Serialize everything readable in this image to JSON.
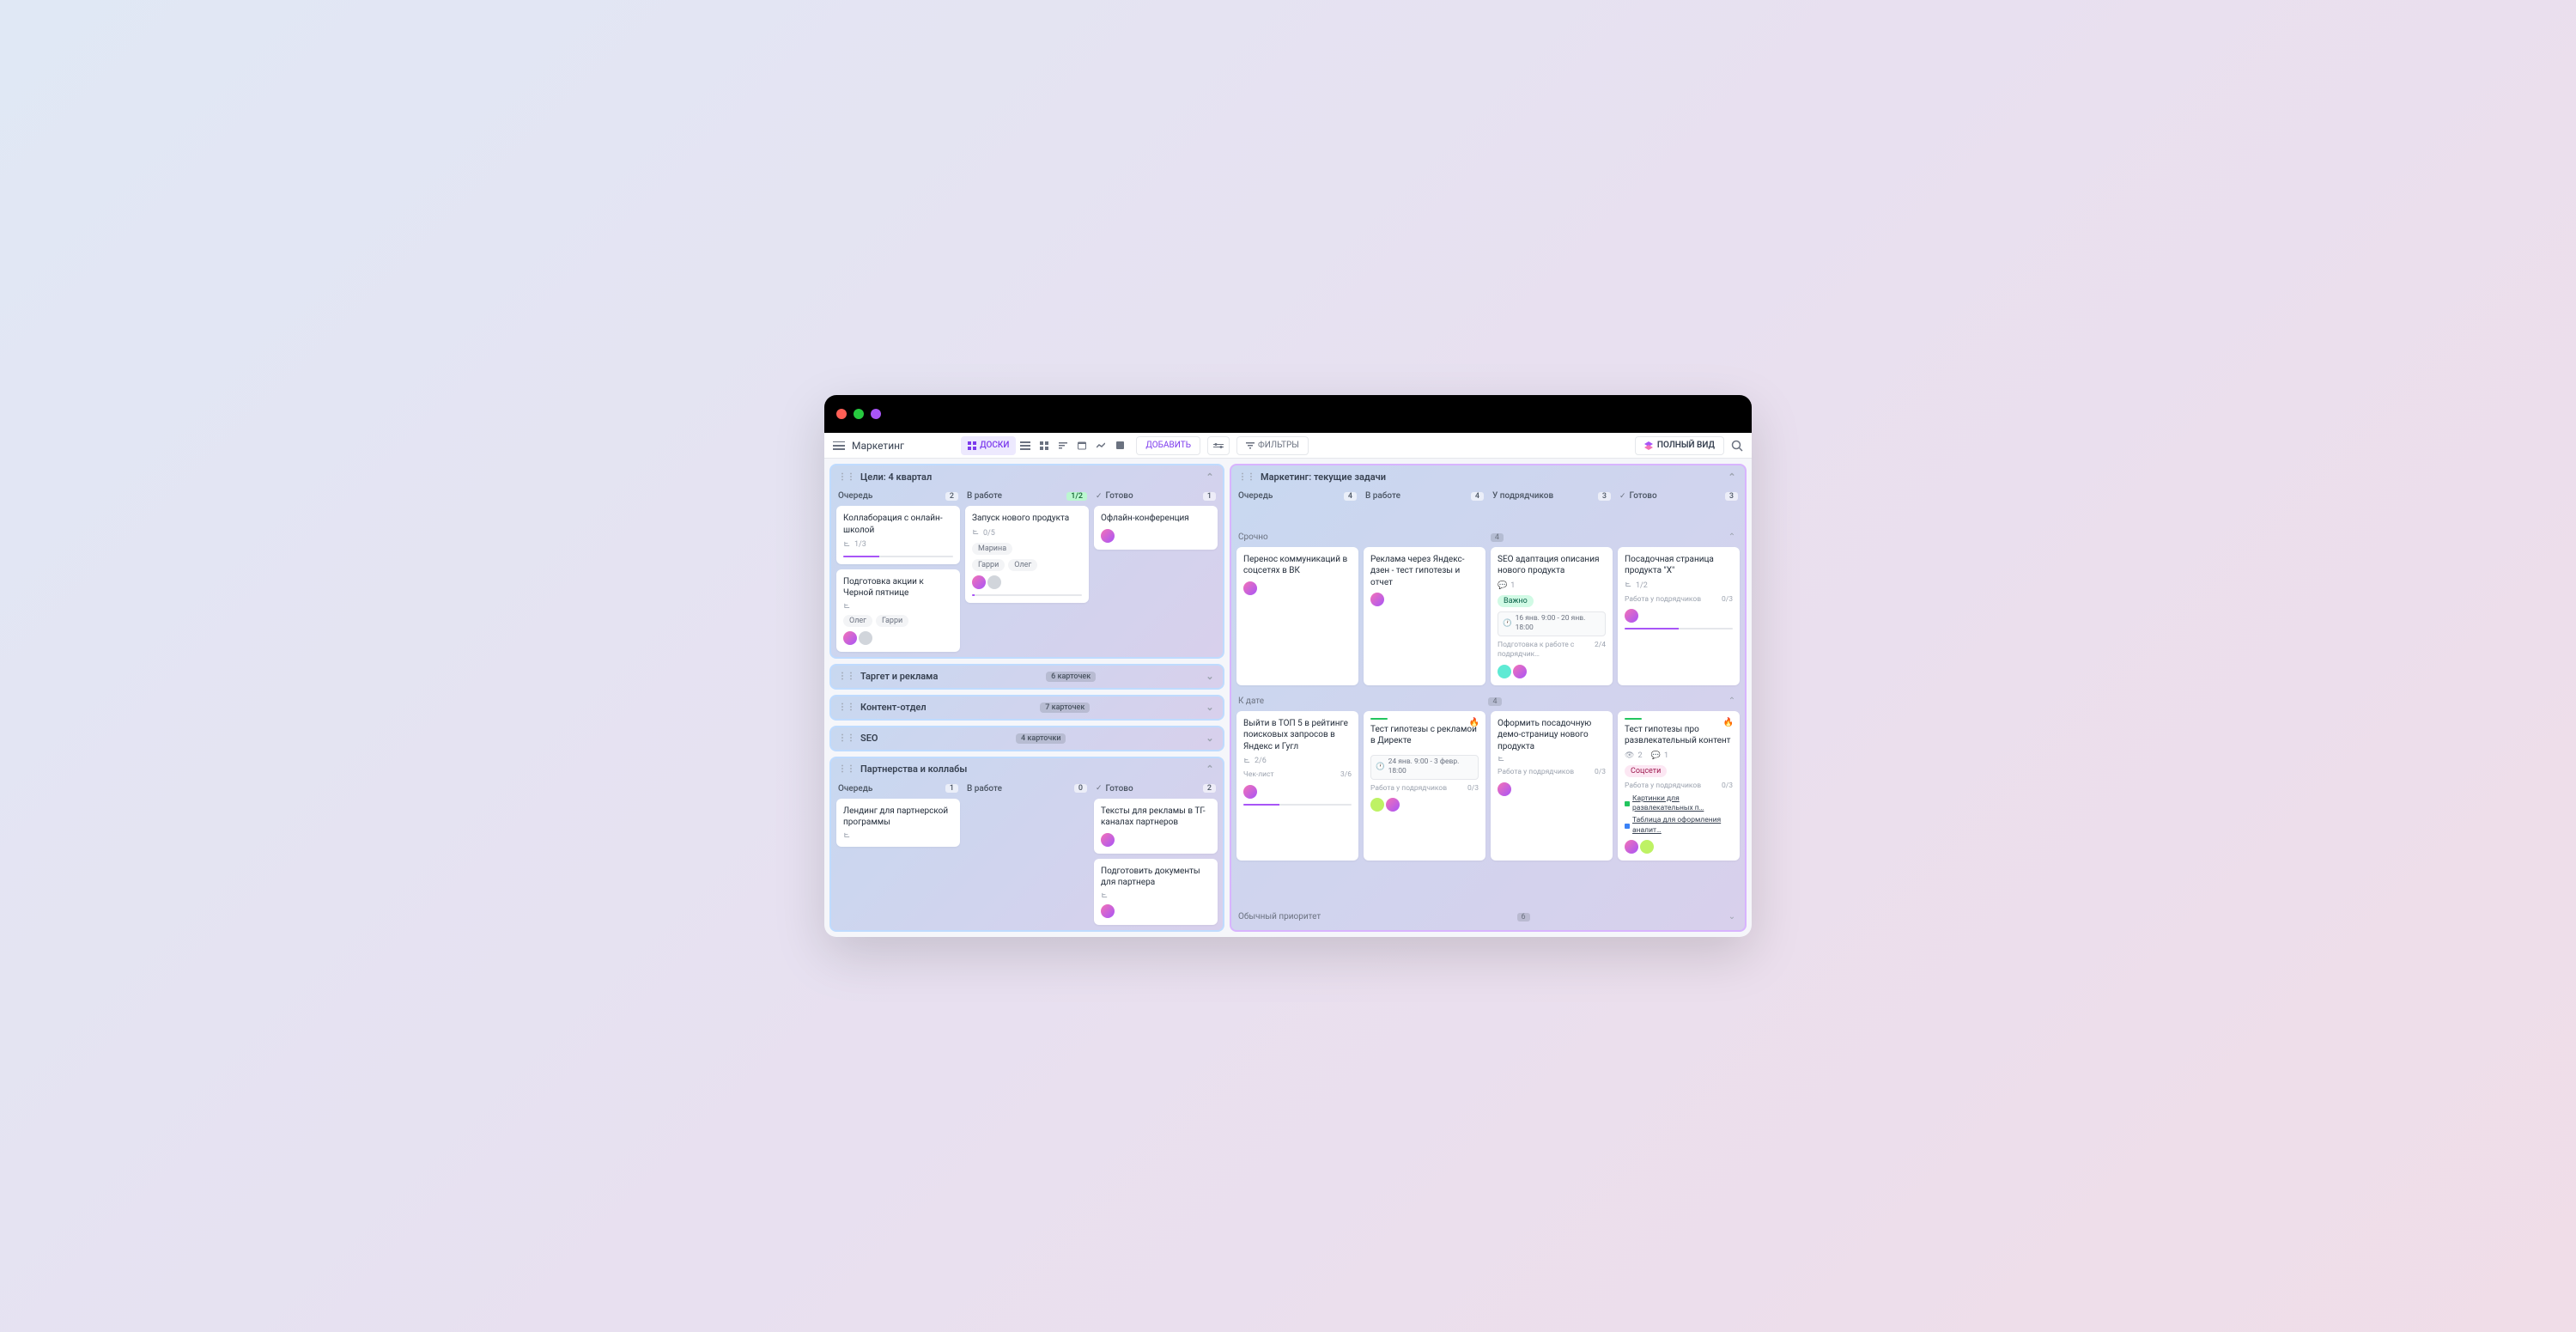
{
  "toolbar": {
    "title": "Маркетинг",
    "boards_label": "ДОСКИ",
    "add_label": "ДОБАВИТЬ",
    "filters_label": "ФИЛЬТРЫ",
    "full_view_label": "ПОЛНЫЙ ВИД"
  },
  "left": {
    "goals": {
      "title": "Цели: 4 квартал",
      "columns": [
        {
          "name": "Очередь",
          "count": "2"
        },
        {
          "name": "В работе",
          "count": "1/2"
        },
        {
          "name": "Готово",
          "count": "1",
          "done": true
        }
      ],
      "c0": [
        {
          "title": "Коллаборация с онлайн-школой",
          "sub": "1/3",
          "progress": 33
        },
        {
          "title": "Подготовка акции к Черной пятнице",
          "tags": [
            "Олег",
            "Гарри"
          ],
          "avatars": 2
        }
      ],
      "c1": [
        {
          "title": "Запуск нового продукта",
          "sub": "0/5",
          "tags": [
            "Марина",
            "Гарри",
            "Олег"
          ],
          "avatars": 2,
          "progress": 0
        }
      ],
      "c2": [
        {
          "title": "Офлайн-конференция",
          "avatars": 1
        }
      ]
    },
    "collapsed": [
      {
        "title": "Таргет и реклама",
        "count": "6 карточек"
      },
      {
        "title": "Контент-отдел",
        "count": "7 карточек"
      },
      {
        "title": "SEO",
        "count": "4 карточки"
      }
    ],
    "partners": {
      "title": "Партнерства и коллабы",
      "columns": [
        {
          "name": "Очередь",
          "count": "1"
        },
        {
          "name": "В работе",
          "count": "0"
        },
        {
          "name": "Готово",
          "count": "2",
          "done": true
        }
      ],
      "c0": [
        {
          "title": "Лендинг для партнерской программы"
        }
      ],
      "c2": [
        {
          "title": "Тексты для рекламы в ТГ-каналах партнеров",
          "avatars": 1
        },
        {
          "title": "Подготовить документы для партнера",
          "avatars": 1
        }
      ]
    }
  },
  "right": {
    "title": "Маркетинг: текущие задачи",
    "columns": [
      {
        "name": "Очередь",
        "count": "4"
      },
      {
        "name": "В работе",
        "count": "4"
      },
      {
        "name": "У подрядчиков",
        "count": "3"
      },
      {
        "name": "Готово",
        "count": "3",
        "done": true
      }
    ],
    "lanes": {
      "urgent": {
        "name": "Срочно",
        "count": "4"
      },
      "bydate": {
        "name": "К дате",
        "count": "4"
      },
      "normal": {
        "name": "Обычный приоритет",
        "count": "6"
      }
    },
    "urgent": [
      {
        "title": "Перенос коммуникаций в соцсетях в ВК",
        "avatars": 1
      },
      {
        "title": "Реклама через Яндекс-дзен - тест гипотезы и отчет",
        "avatars": 1
      },
      {
        "title": "SEO адаптация описания нового продукта",
        "comments": "1",
        "tag_green": "Важно",
        "date": "16 янв. 9:00 - 20 янв. 18:00",
        "sub_label": "Подготовка к работе с подрядчик…",
        "sub_count": "2/4",
        "avatars": 2,
        "teal": true
      },
      {
        "title": "Посадочная страница продукта \"X\"",
        "sub": "1/2",
        "sub_label": "Работа у подрядчиков",
        "sub_count": "0/3",
        "avatars": 1,
        "progress": 50
      }
    ],
    "bydate": [
      {
        "title": "Выйти в ТОП 5 в рейтинге поисковых запросов в Яндекс и Гугл",
        "sub": "2/6",
        "checklist": "Чек-лист",
        "checklist_count": "3/6",
        "avatars": 1,
        "progress": 33
      },
      {
        "title": "Тест гипотезы с рекламой в Директе",
        "greenbar": true,
        "flame": true,
        "date": "24 янв. 9:00 - 3 февр. 18:00",
        "sub_label": "Работа у подрядчиков",
        "sub_count": "0/3",
        "avatars": 2,
        "lime": true
      },
      {
        "title": "Оформить посадочную демо-страницу нового продукта",
        "sub_label": "Работа у подрядчиков",
        "sub_count": "0/3",
        "avatars": 1
      },
      {
        "title": "Тест гипотезы про развлекательный контент",
        "greenbar": true,
        "flame": true,
        "eye": "2",
        "comments": "1",
        "tag_pink": "Соцсети",
        "sub_label": "Работа у подрядчиков",
        "sub_count": "0/3",
        "link1": "Картинки для развлекательных п…",
        "link2": "Таблица для оформления аналит…",
        "avatars": 2,
        "lime": true
      }
    ]
  }
}
